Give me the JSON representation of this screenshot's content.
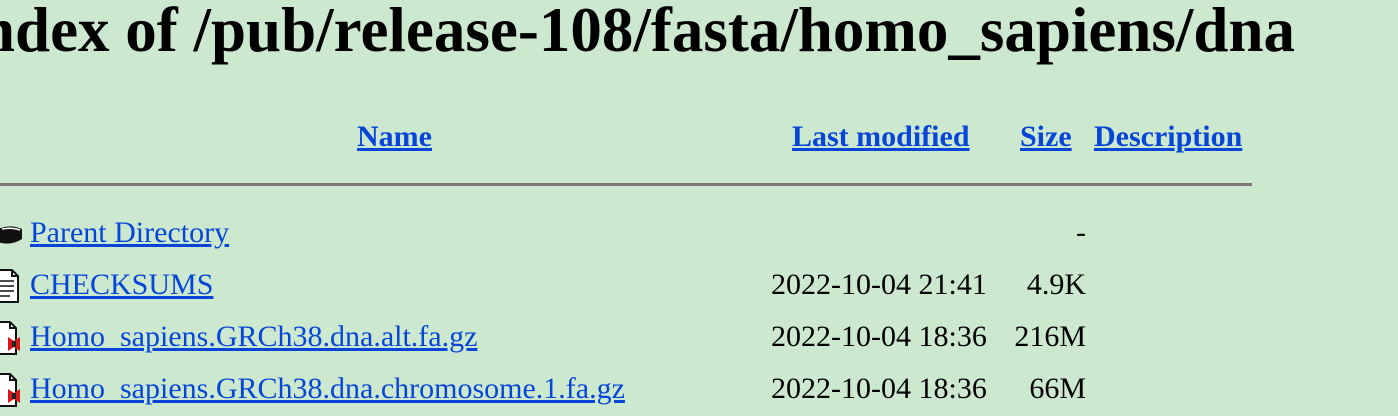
{
  "page": {
    "title": "ndex of /pub/release-108/fasta/homo_sapiens/dna"
  },
  "columns": {
    "name": "Name",
    "last_modified": "Last modified",
    "size": "Size",
    "description": "Description"
  },
  "rows": [
    {
      "icon": "back-icon",
      "name": "Parent Directory",
      "date": "",
      "size": "-"
    },
    {
      "icon": "text-file-icon",
      "name": "CHECKSUMS",
      "date": "2022-10-04 21:41",
      "size": "4.9K"
    },
    {
      "icon": "compressed-file-icon",
      "name": "Homo_sapiens.GRCh38.dna.alt.fa.gz",
      "date": "2022-10-04 18:36",
      "size": "216M"
    },
    {
      "icon": "compressed-file-icon",
      "name": "Homo_sapiens.GRCh38.dna.chromosome.1.fa.gz",
      "date": "2022-10-04 18:36",
      "size": "66M"
    }
  ]
}
